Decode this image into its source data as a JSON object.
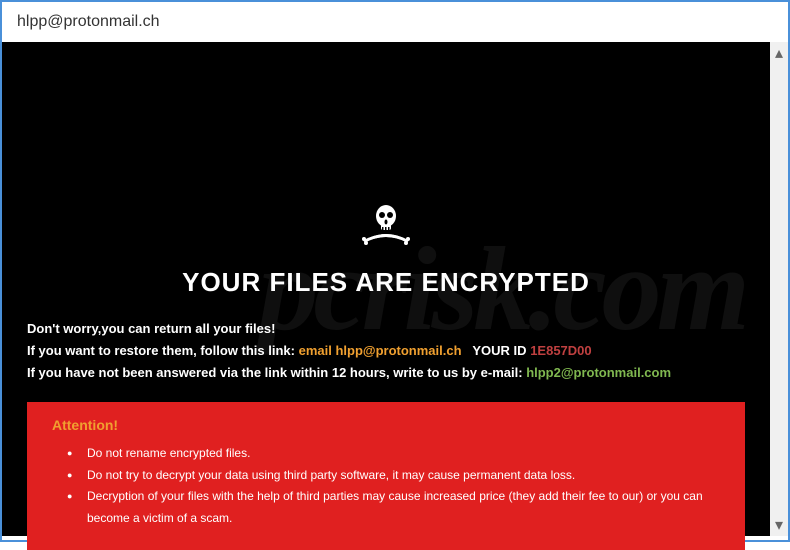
{
  "window": {
    "title": "hlpp@protonmail.ch"
  },
  "heading": "YOUR FILES ARE ENCRYPTED",
  "messages": {
    "line1": "Don't worry,you can return all your files!",
    "line2_prefix": "If you want to restore them, follow this link:",
    "line2_email_label": "email",
    "line2_email": "hlpp@protonmail.ch",
    "line2_id_label": "YOUR ID",
    "line2_id": "1E857D00",
    "line3_prefix": "If you have not been answered via the link within 12 hours, write to us by e-mail:",
    "line3_email": "hlpp2@protonmail.com"
  },
  "attention": {
    "title": "Attention!",
    "items": [
      "Do not rename encrypted files.",
      "Do not try to decrypt your data using third party software, it may cause permanent data loss.",
      "Decryption of your files with the help of third parties may cause increased price (they add their fee to our) or you can become a victim of a scam."
    ]
  },
  "icons": {
    "skull": "skull-crossbones-icon",
    "scroll_up": "▴",
    "scroll_down": "▾"
  }
}
